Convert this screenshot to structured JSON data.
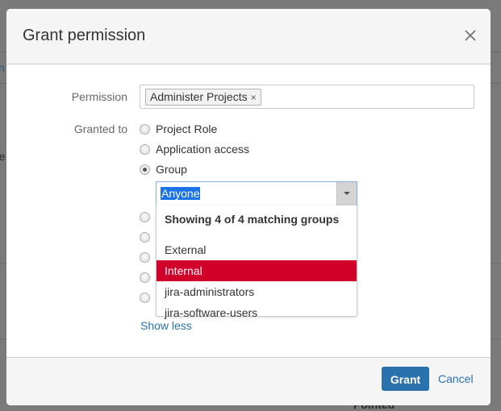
{
  "background": {
    "link_fragment": "n",
    "text_fragment": "re",
    "bottom_text_fragment": "Pointed"
  },
  "dialog": {
    "title": "Grant permission",
    "close_icon": "close-icon",
    "permission": {
      "label": "Permission",
      "tags": [
        {
          "label": "Administer Projects",
          "remove_glyph": "×"
        }
      ]
    },
    "granted_to": {
      "label": "Granted to",
      "options": [
        {
          "label": "Project Role",
          "checked": false
        },
        {
          "label": "Application access",
          "checked": false
        },
        {
          "label": "Group",
          "checked": true
        }
      ],
      "group_select": {
        "value": "Anyone",
        "dropdown": {
          "header": "Showing 4 of 4 matching groups",
          "items": [
            {
              "label": "External",
              "active": false
            },
            {
              "label": "Internal",
              "active": true
            },
            {
              "label": "jira-administrators",
              "active": false
            },
            {
              "label": "jira-software-users",
              "active": false
            }
          ]
        }
      },
      "hidden_radio_count": 5,
      "show_less": "Show less"
    },
    "footer": {
      "grant_label": "Grant",
      "cancel_label": "Cancel"
    }
  },
  "colors": {
    "primary": "#2a72ad",
    "highlight": "#d0002b",
    "overlay": "#7a7a7a"
  }
}
